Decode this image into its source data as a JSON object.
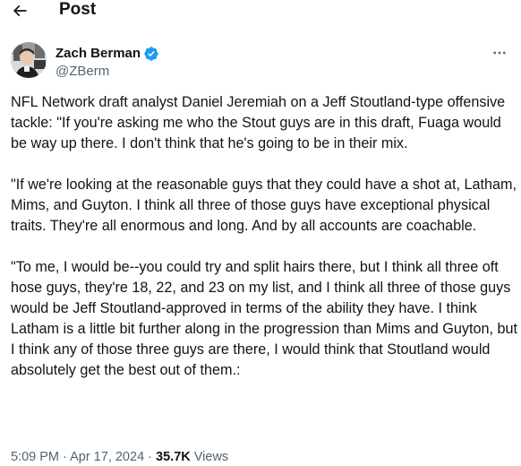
{
  "header": {
    "title": "Post",
    "back_icon": "arrow-left-icon"
  },
  "author": {
    "display_name": "Zach Berman",
    "handle": "@ZBerm",
    "verified_icon": "verified-badge-icon",
    "verified_color": "#1d9bf0",
    "more_icon": "more-horizontal-icon"
  },
  "tweet": {
    "paragraphs": [
      "NFL Network draft analyst Daniel Jeremiah on a Jeff Stoutland-type offensive tackle: \"If you're asking me who the Stout guys are in this draft, Fuaga would be way up there. I don't think that he's going to be in their mix.",
      "\"If we're looking at the reasonable guys that they could have a shot at, Latham, Mims, and Guyton. I think all three of those guys have exceptional physical traits. They're all enormous and long. And by all accounts are coachable.",
      "\"To me, I would be--you could try and split hairs there, but I think all three oft hose guys, they're 18, 22, and 23 on my list, and I think all three of those guys would be Jeff Stoutland-approved in terms of the ability they have. I think Latham is a little bit further along in the progression than Mims and Guyton, but I think any of those three guys are there, I would think that Stoutland would absolutely get the best out of them.:"
    ]
  },
  "meta": {
    "time": "5:09 PM",
    "separator": " · ",
    "date": "Apr 17, 2024",
    "views_count": "35.7K",
    "views_label": " Views"
  },
  "colors": {
    "text_primary": "#0f1419",
    "text_secondary": "#536471",
    "accent": "#1d9bf0"
  }
}
